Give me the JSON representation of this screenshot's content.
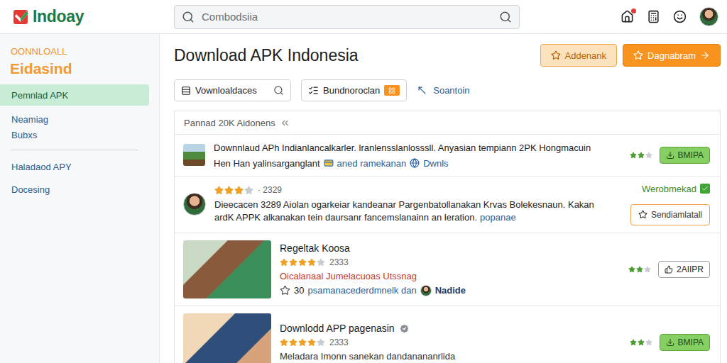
{
  "header": {
    "logo": "Indoay",
    "search_placeholder": "Combodsiia",
    "notifications": true
  },
  "sidebar": {
    "kicker": "OONNLOALL",
    "title": "Eidasind",
    "groups": [
      [
        {
          "label": "Pemnlad APK",
          "selected": true
        },
        {
          "label": "Neamiag",
          "selected": false
        },
        {
          "label": "Bubxs",
          "selected": false
        }
      ],
      [
        {
          "label": "Haladaod APY",
          "selected": false
        },
        {
          "label": "Docesing",
          "selected": false
        }
      ]
    ]
  },
  "page": {
    "title": "Download APK Indonesia",
    "buttons": [
      {
        "label": "Addenank",
        "kind": "light"
      },
      {
        "label": "Dagnabram",
        "kind": "solid"
      }
    ]
  },
  "filters": {
    "search": "Vownloaldaces",
    "dropdown": "Bundnoroclan",
    "link": "Soantoin"
  },
  "list": {
    "heading": "Pannad 20K Aidonens",
    "items": [
      {
        "kind": "brief",
        "text": "Downnlaud APh Indianlancalkarler. lranlensslanlosssll. Anyasian tempiann 2PK Hongmacuin",
        "meta": [
          "Hen Han yalinsarganglant",
          "aned ramekanan",
          "Dwnls"
        ],
        "side": {
          "kind": "rating",
          "stars": 2
        },
        "action": {
          "label": "BMIPA",
          "kind": "green"
        }
      },
      {
        "kind": "review",
        "stars": 3,
        "count": "· 2329",
        "lines": [
          "Dieecacen 3289 Aiolan ogarkeiar kandeanar Pargenbatollanakan Krvas Bolekesnaun. Kakan",
          "ardK APPK alkanakan tein daursanr fancemslanainn an leration."
        ],
        "link": "popanae",
        "side": {
          "kind": "badge",
          "label": "Werobmekad"
        },
        "action": {
          "label": "Sendiamlatall",
          "kind": "orange"
        }
      },
      {
        "kind": "media",
        "title": "Regeltak Koosa",
        "verified": false,
        "stars": 4,
        "count": "2333",
        "subtitle": "Oicalanaal Jumelacuoas Utssnag",
        "subtitle_color": "#c0392b",
        "meta": [
          "30",
          "psamanacederdmnelk dan",
          "Nadide"
        ],
        "side": {
          "kind": "rating",
          "stars": 2
        },
        "action": {
          "label": "2AIIPR",
          "kind": "outline"
        }
      },
      {
        "kind": "media",
        "title": "Downlodd APP pagenasin",
        "verified": true,
        "stars": 4,
        "count": "2333",
        "subtitle": "Meladara Imonn sanekan dandanananrlida",
        "subtitle_color": "#333333",
        "meta": [],
        "side": {
          "kind": "rating",
          "stars": 2
        },
        "action": {
          "label": "BMIPA",
          "kind": "green"
        }
      }
    ]
  }
}
